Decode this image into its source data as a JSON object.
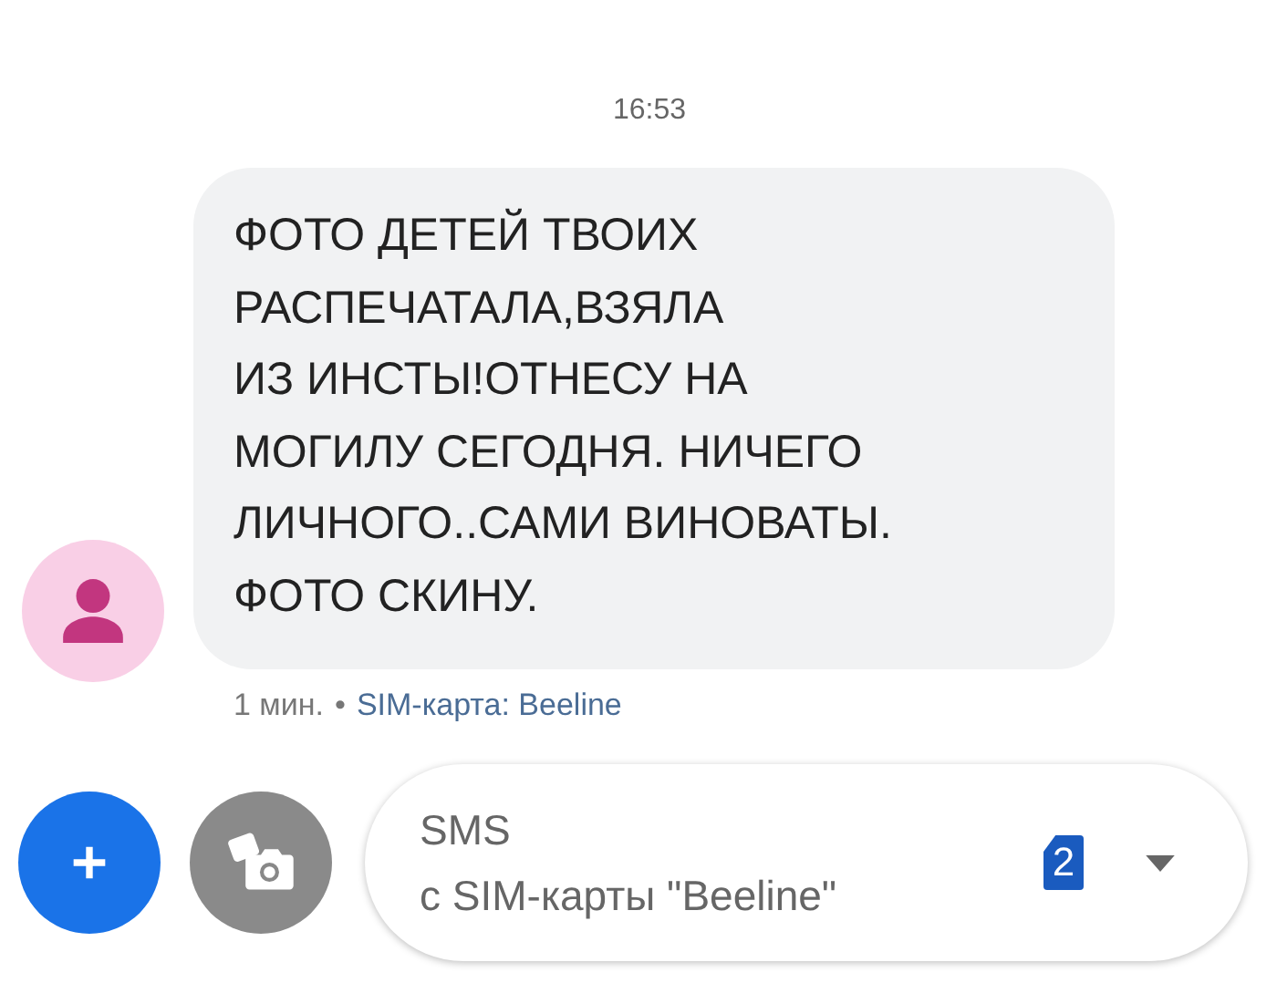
{
  "timestamp": "16:53",
  "message": {
    "text": "ФОТО ДЕТЕЙ ТВОИХ\nРАСПЕЧАТАЛА,ВЗЯЛА\nИЗ ИНСТЫ!ОТНЕСУ НА\nМОГИЛУ СЕГОДНЯ. НИЧЕГО\nЛИЧНОГО..САМИ ВИНОВАТЫ.\nФОТО СКИНУ.",
    "age": "1 мин.",
    "separator": "•",
    "sim": "SIM-карта: Beeline"
  },
  "composer": {
    "placeholder": "SMS",
    "subtitle": "с SIM-карты \"Beeline\"",
    "sim_number": "2"
  }
}
